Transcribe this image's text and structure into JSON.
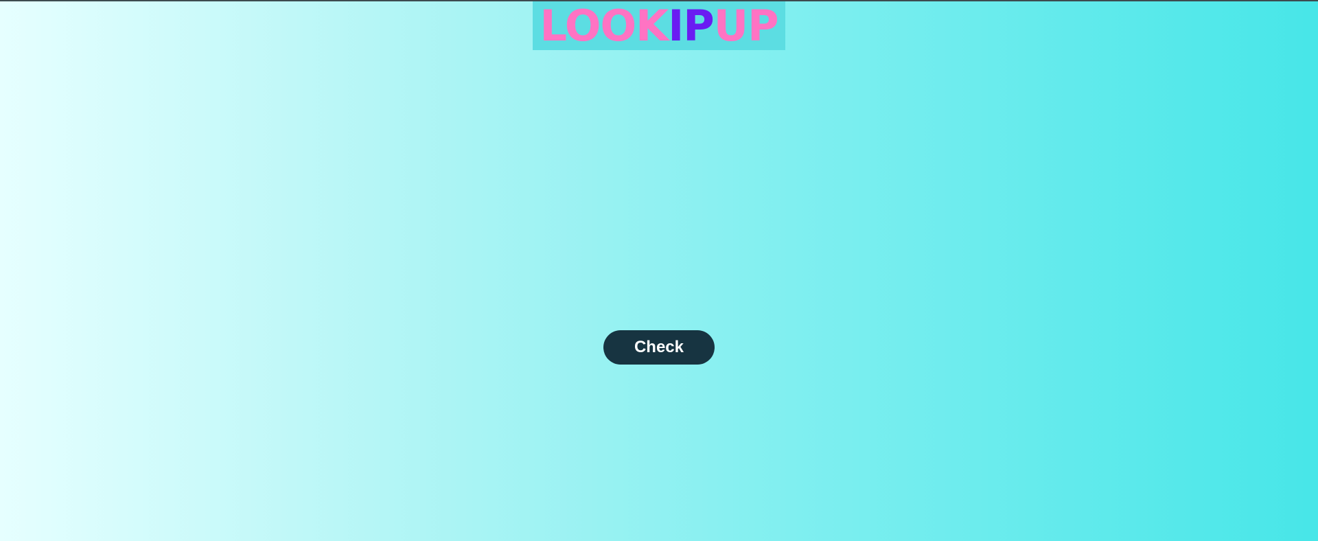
{
  "logo": {
    "part_a": "LOOK",
    "part_b": "IP",
    "part_c": "UP",
    "colors": {
      "pink": "#ff73c3",
      "purple": "#6a1cf2",
      "background": "#5cdde2"
    }
  },
  "actions": {
    "check_label": "Check"
  },
  "theme": {
    "gradient_start": "#e6ffff",
    "gradient_end": "#47e6e8",
    "button_color": "#173441"
  }
}
